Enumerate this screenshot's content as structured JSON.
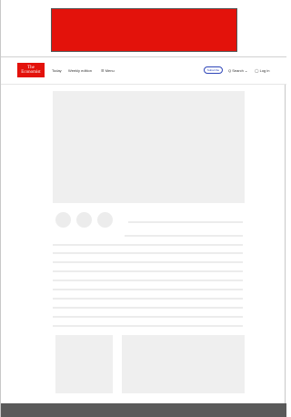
{
  "header": {
    "logo_text": "The Economist",
    "nav": {
      "today": "Today",
      "weekly": "Weekly edition",
      "menu": "☰ Menu"
    },
    "subscribe": "Subscribe",
    "search": "Q Search ⌄",
    "login": "◯ Log in"
  },
  "colors": {
    "brand_red": "#e3120b",
    "subscribe_blue": "#2e45b8",
    "placeholder_gray": "#efefef",
    "footer_gray": "#5a5a5a"
  }
}
